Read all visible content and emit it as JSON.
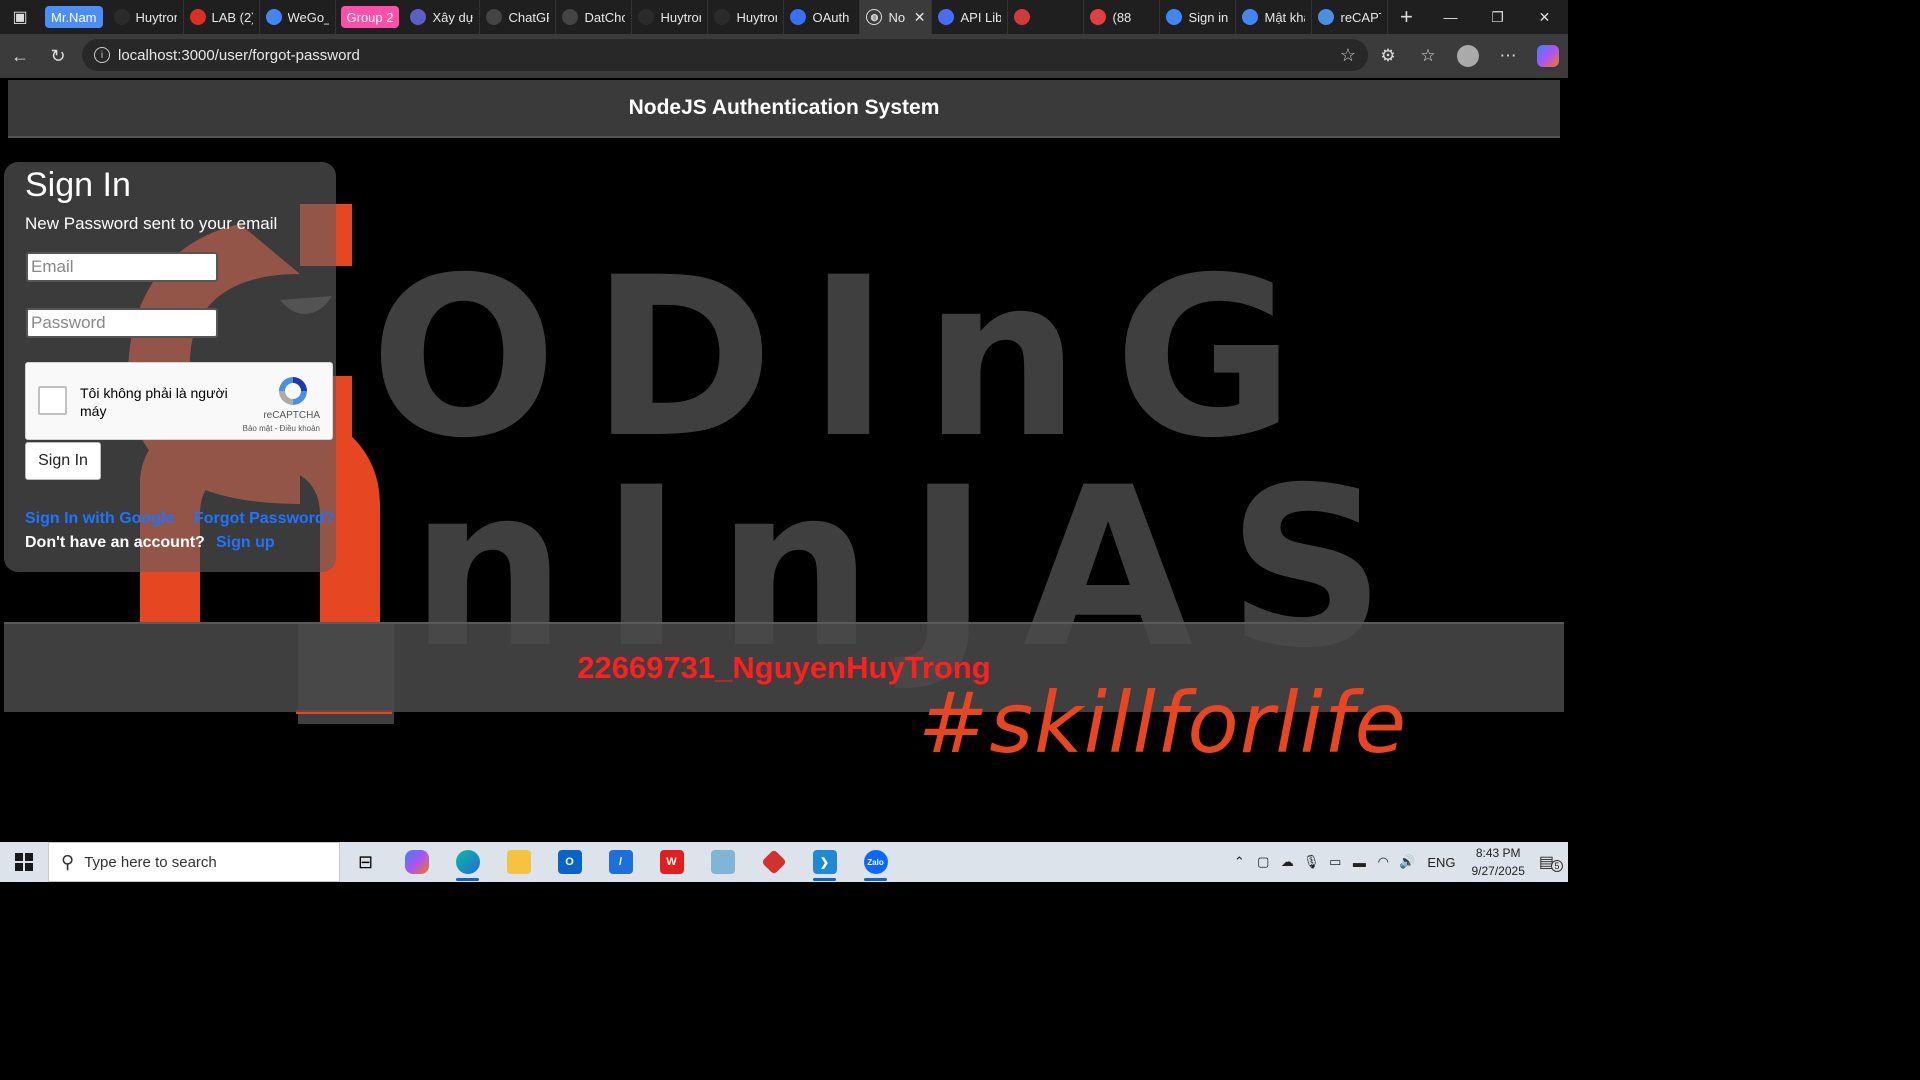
{
  "browser": {
    "tab_groups": [
      {
        "label": "Mr.Nam",
        "color": "#4c8df6"
      },
      {
        "label": "Group 2",
        "color": "#ff4fa8"
      }
    ],
    "tabs_before_group2": [
      {
        "label": "Huytron",
        "icon": "github-icon",
        "color": "#2b2b2b"
      },
      {
        "label": "LAB (2)",
        "icon": "pdf-icon",
        "color": "#d93025"
      },
      {
        "label": "WeGo_u",
        "icon": "docs-icon",
        "color": "#4285f4"
      }
    ],
    "tabs_after_group2": [
      {
        "label": "Xây dựn",
        "icon": "app-icon",
        "color": "#5b5fc7"
      },
      {
        "label": "ChatGP",
        "icon": "chatgpt-icon",
        "color": "#444444"
      },
      {
        "label": "DatCho",
        "icon": "share-icon",
        "color": "#444444"
      },
      {
        "label": "Huytron",
        "icon": "github-icon",
        "color": "#2b2b2b"
      },
      {
        "label": "Huytron",
        "icon": "github-icon",
        "color": "#2b2b2b"
      },
      {
        "label": "OAuth (",
        "icon": "shield-icon",
        "color": "#3a6ff7"
      }
    ],
    "active_tab": {
      "label": "No",
      "icon": "globe-icon"
    },
    "tabs_after_active": [
      {
        "label": "API Libr",
        "icon": "api-icon",
        "color": "#4a6cf7"
      },
      {
        "label": "",
        "icon": "888-icon",
        "color": "#d23a3a"
      },
      {
        "label": "(88",
        "icon": "record-icon",
        "color": "#e04040"
      },
      {
        "label": "Sign in",
        "icon": "google-icon",
        "color": "#4285f4"
      },
      {
        "label": "Mật khẩ",
        "icon": "google-icon",
        "color": "#4285f4"
      },
      {
        "label": "reCAPT",
        "icon": "recaptcha-icon",
        "color": "#4a90e2"
      }
    ],
    "url": "localhost:3000/user/forgot-password"
  },
  "page": {
    "header_title": "NodeJS Authentication System",
    "background_words": [
      "ODInG",
      "nInJAS"
    ],
    "background_tagline": "#skillforlife",
    "footer_text": "22669731_NguyenHuyTrong",
    "accent_color": "#e64621"
  },
  "signin": {
    "title": "Sign In",
    "message": "New Password sent to your email",
    "email_placeholder": "Email",
    "password_placeholder": "Password",
    "captcha_label": "Tôi không phải là người máy",
    "captcha_brand": "reCAPTCHA",
    "captcha_terms": "Bảo mật - Điều khoản",
    "submit_label": "Sign In",
    "google_link": "Sign In with Google",
    "forgot_link": "Forgot Password?",
    "no_account_text": "Don't have an account?",
    "signup_link": "Sign up",
    "link_color": "#1e74ff"
  },
  "taskbar": {
    "search_placeholder": "Type here to search",
    "language": "ENG",
    "time": "8:43 PM",
    "date": "9/27/2025",
    "notification_count": "5"
  }
}
